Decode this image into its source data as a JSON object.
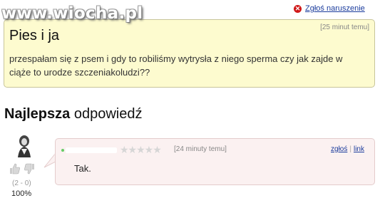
{
  "watermark": "www.wiocha.pl",
  "report": {
    "icon": "close-circle-icon",
    "label": "Zgłoś naruszenie"
  },
  "question": {
    "time": "[25 minut temu]",
    "title": "Pies i ja",
    "body": "przespałam się z psem i gdy to robiliśmy wytrysła z niego sperma czy jak zajde w ciąże to urodze szczeniakoludzi??"
  },
  "best_answer": {
    "heading_bold": "Najlepsza",
    "heading_rest": " odpowiedź",
    "rating": "★★★★★",
    "time": "[24 minuty temu]",
    "report_link": "zgłoś",
    "link_label": "link",
    "text": "Tak.",
    "vote_counts": "(2 - 0)",
    "vote_percent": "100%"
  },
  "colors": {
    "question_bg": "#fdfbcf",
    "answer_bg": "#fbf1f1",
    "link": "#1a3b9c",
    "report_icon": "#d01818"
  }
}
